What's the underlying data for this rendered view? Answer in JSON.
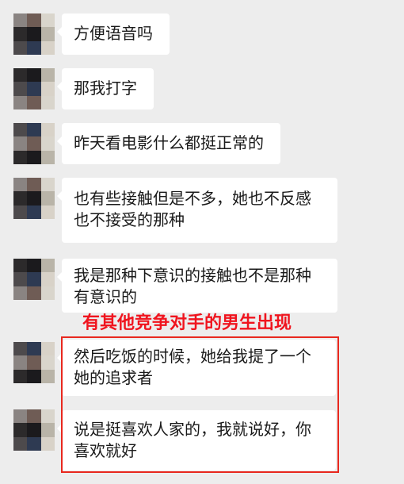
{
  "messages": [
    {
      "lines": [
        "方便语音吗"
      ]
    },
    {
      "lines": [
        "那我打字"
      ]
    },
    {
      "lines": [
        "昨天看电影什么都挺正常的"
      ]
    },
    {
      "lines": [
        "也有些接触但是不多，她也不反感",
        "也不接受的那种"
      ]
    },
    {
      "lines": [
        "我是那种下意识的接触也不是那种",
        "有意识的"
      ]
    },
    {
      "lines": [
        "然后吃饭的时候，她给我提了一个",
        "她的追求者"
      ]
    },
    {
      "lines": [
        "说是挺喜欢人家的，我就说好，你",
        "喜欢就好"
      ]
    }
  ],
  "annotation": "有其他竞争对手的男生出现",
  "colors": {
    "background": "#ededed",
    "bubble": "#ffffff",
    "text": "#1a1a1a",
    "annotation": "#f0141e",
    "highlight_border": "#e8281e"
  },
  "avatar_palette": [
    [
      "#8a8482",
      "#6f5c55",
      "#d9d5cc"
    ],
    [
      "#2c2a2b",
      "#1b1a1d",
      "#b9b4a8"
    ],
    [
      "#4d4a4c",
      "#2e3a52",
      "#d8d2c8"
    ]
  ]
}
